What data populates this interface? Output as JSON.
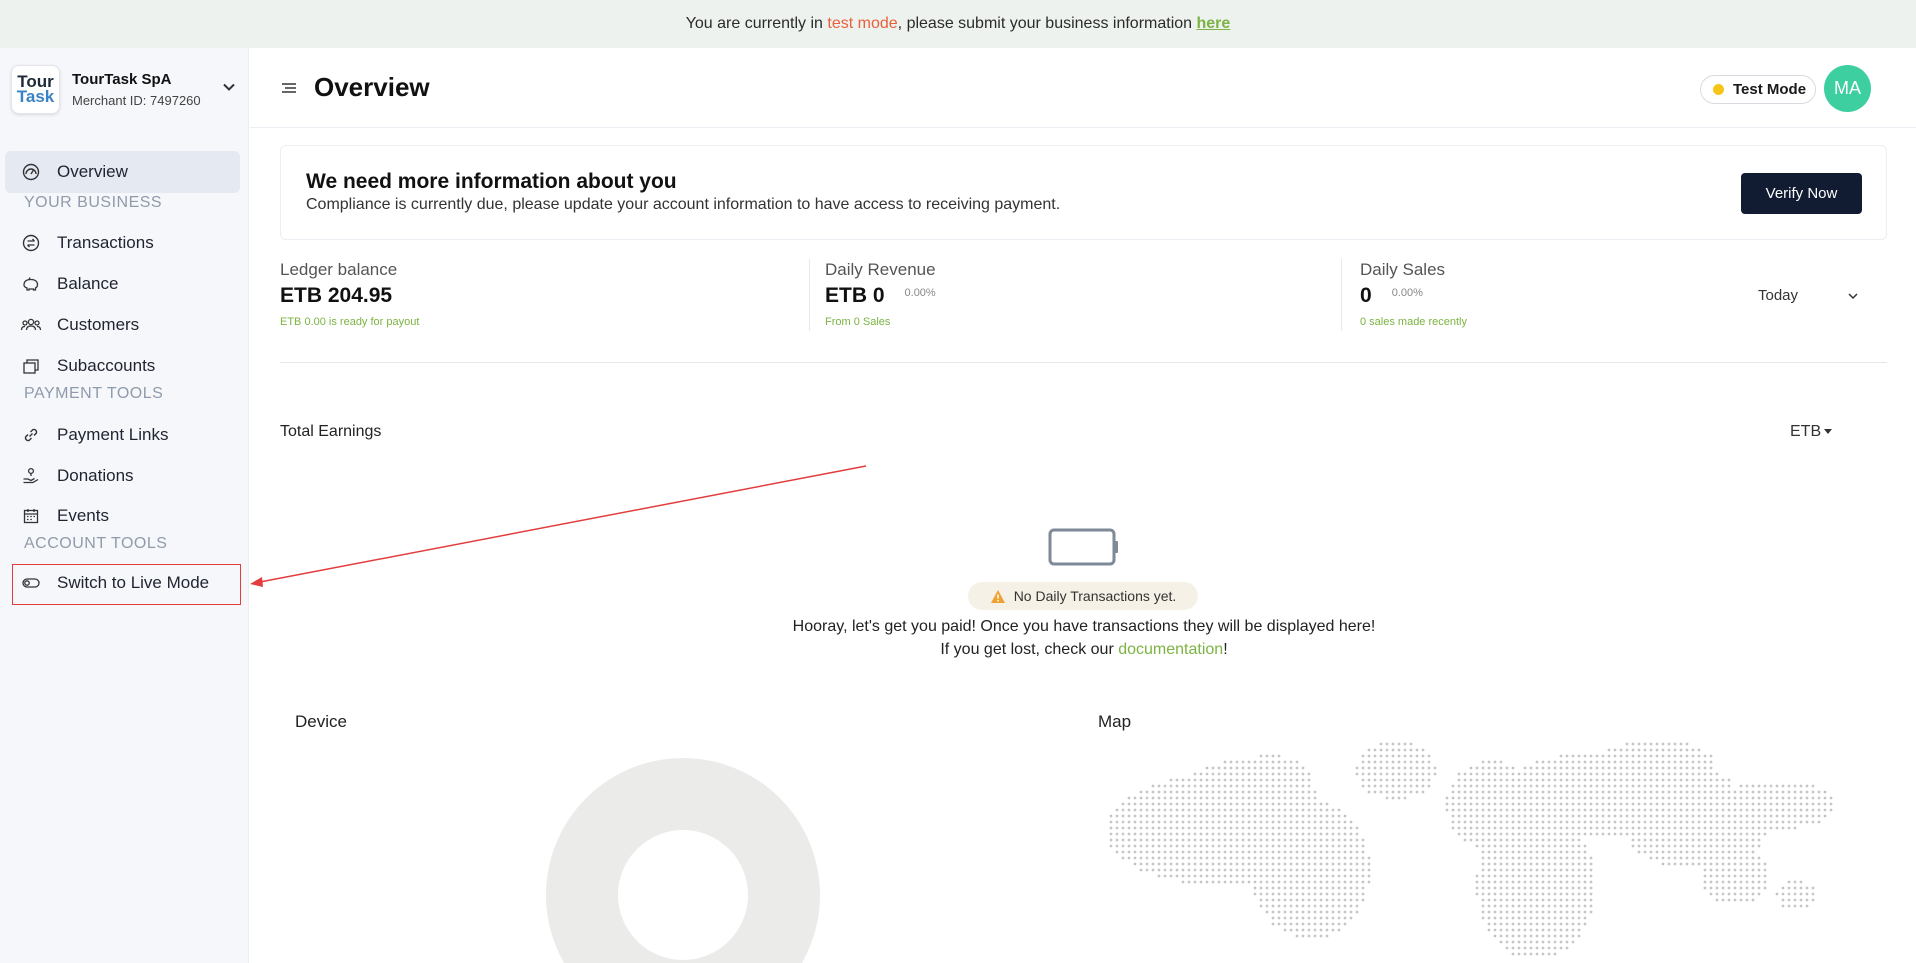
{
  "banner": {
    "prefix": "You are currently in ",
    "mode_text": "test mode",
    "middle": ", please submit your business information ",
    "link_text": "here"
  },
  "merchant": {
    "logo_line1": "Tour",
    "logo_line2": "Task",
    "name": "TourTask SpA",
    "id_text": "Merchant ID: 7497260"
  },
  "sidebar": {
    "overview": "Overview",
    "section_business": "YOUR BUSINESS",
    "transactions": "Transactions",
    "balance": "Balance",
    "customers": "Customers",
    "subaccounts": "Subaccounts",
    "section_payment": "PAYMENT TOOLS",
    "payment_links": "Payment Links",
    "donations": "Donations",
    "events": "Events",
    "section_account": "ACCOUNT TOOLS",
    "switch_live": "Switch to Live Mode"
  },
  "header": {
    "title": "Overview",
    "mode_badge": "Test Mode",
    "avatar_initials": "MA"
  },
  "notice": {
    "title": "We need more information about you",
    "description": "Compliance is currently due, please update your account information to have access to receiving payment.",
    "button": "Verify Now"
  },
  "stats": {
    "ledger": {
      "label": "Ledger balance",
      "value": "ETB 204.95",
      "sub": "ETB 0.00 is ready for payout"
    },
    "revenue": {
      "label": "Daily Revenue",
      "value": "ETB 0",
      "pct": "0.00%",
      "sub": "From 0 Sales"
    },
    "sales": {
      "label": "Daily Sales",
      "value": "0",
      "pct": "0.00%",
      "sub": "0 sales made recently"
    },
    "period": "Today"
  },
  "earnings": {
    "label": "Total Earnings",
    "currency": "ETB"
  },
  "empty_state": {
    "badge": "No Daily Transactions yet.",
    "line1": "Hooray, let's get you paid! Once you have transactions they will be displayed here!",
    "line2_prefix": "If you get lost, check our ",
    "line2_link": "documentation",
    "line2_suffix": "!"
  },
  "panels": {
    "device": "Device",
    "map": "Map"
  },
  "colors": {
    "accent_green": "#7cb342",
    "test_mode_orange": "#e8603c",
    "verify_button": "#111c33",
    "avatar": "#3ecfa0",
    "annotation_red": "#e23c3c"
  }
}
